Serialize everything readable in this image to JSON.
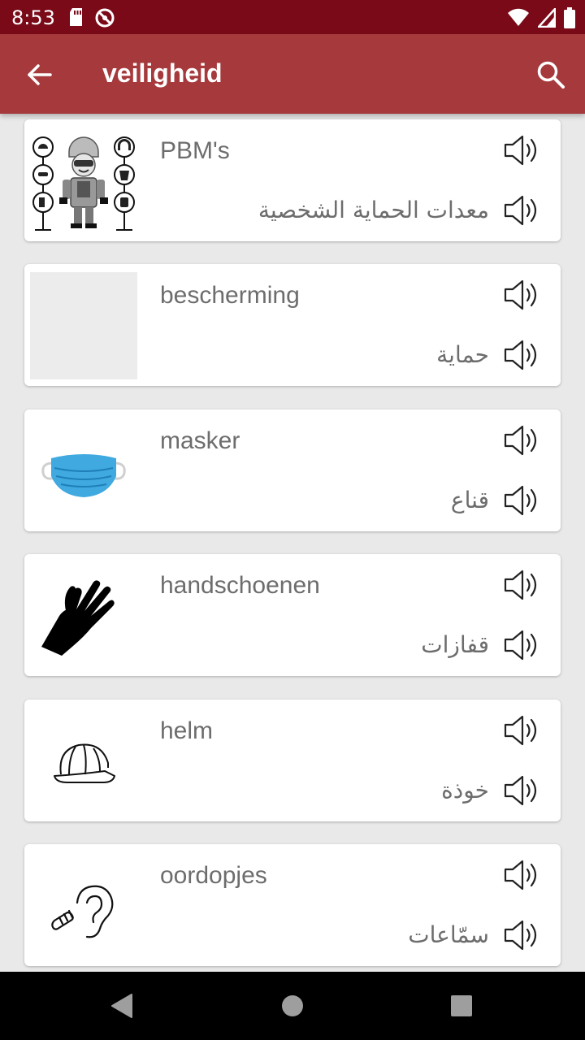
{
  "status_bar": {
    "time": "8:53",
    "icons": [
      "sd-card-icon",
      "do-not-disturb-icon",
      "wifi-icon",
      "signal-icon",
      "battery-icon"
    ]
  },
  "app_bar": {
    "title": "veiligheid",
    "back_icon": "arrow-left-icon",
    "search_icon": "search-icon",
    "color": "#a5393c"
  },
  "items": [
    {
      "nl": "PBM's",
      "ar": "معدات الحماية الشخصية",
      "image": "ppe-worker-illustration"
    },
    {
      "nl": "bescherming",
      "ar": "حماية",
      "image": "blank-placeholder"
    },
    {
      "nl": "masker",
      "ar": "قناع",
      "image": "face-mask"
    },
    {
      "nl": "handschoenen",
      "ar": "قفازات",
      "image": "glove"
    },
    {
      "nl": "helm",
      "ar": "خوذة",
      "image": "hard-hat"
    },
    {
      "nl": "oordopjes",
      "ar": "سمّاعات",
      "image": "ear-plugs"
    }
  ],
  "nav_bar": {
    "buttons": [
      "back-triangle-icon",
      "home-circle-icon",
      "recents-square-icon"
    ]
  }
}
